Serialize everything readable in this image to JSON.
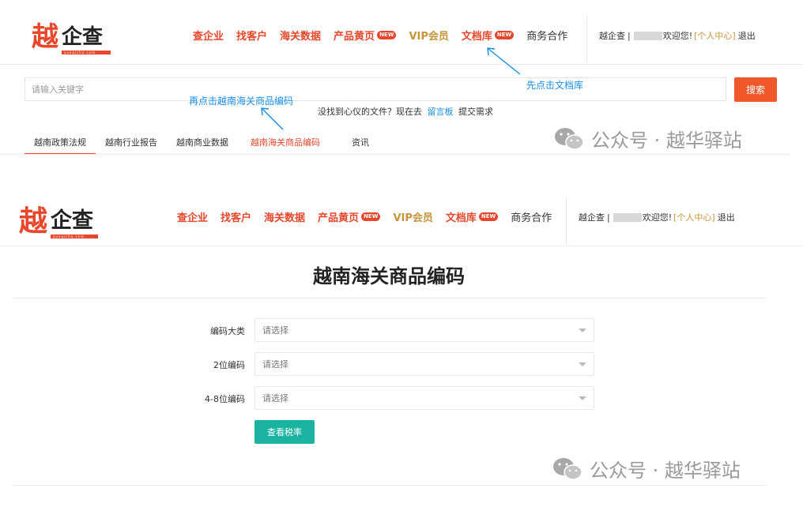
{
  "top": {
    "logo": {
      "char1": "越",
      "rest": "企查",
      "tagline": "yueqicha.com"
    },
    "nav": [
      {
        "label": "查企业",
        "style": "red"
      },
      {
        "label": "找客户",
        "style": "red"
      },
      {
        "label": "海关数据",
        "style": "red"
      },
      {
        "label": "产品黄页",
        "style": "red",
        "badge": "NEW"
      },
      {
        "label": "VIP会员",
        "style": "gold"
      },
      {
        "label": "文档库",
        "style": "red",
        "badge": "NEW"
      },
      {
        "label": "商务合作",
        "style": "dark"
      }
    ],
    "user": {
      "site": "越企查",
      "sep": "|",
      "welcome": "欢迎您!",
      "center": "[个人中心]",
      "logout": "退出"
    },
    "search": {
      "placeholder": "请输入关键字",
      "button": "搜索"
    },
    "hint": {
      "prefix": "没找到心仪的文件？现在去",
      "link": "留言板",
      "suffix": "提交需求"
    },
    "tabs": [
      {
        "label": "越南政策法规",
        "underline": true
      },
      {
        "label": "越南行业报告"
      },
      {
        "label": "越南商业数据"
      },
      {
        "label": "越南海关商品编码",
        "active": true
      },
      {
        "label": "资讯"
      }
    ],
    "annotations": {
      "first": "先点击文档库",
      "second": "再点击越南海关商品编码"
    },
    "watermark": "公众号 · 越华驿站"
  },
  "bottom": {
    "logo": {
      "char1": "越",
      "rest": "企查",
      "tagline": "yueqicha.com"
    },
    "nav": [
      {
        "label": "查企业",
        "style": "red"
      },
      {
        "label": "找客户",
        "style": "red"
      },
      {
        "label": "海关数据",
        "style": "red"
      },
      {
        "label": "产品黄页",
        "style": "red",
        "badge": "NEW"
      },
      {
        "label": "VIP会员",
        "style": "gold"
      },
      {
        "label": "文档库",
        "style": "red",
        "badge": "NEW"
      },
      {
        "label": "商务合作",
        "style": "dark"
      }
    ],
    "user": {
      "site": "越企查",
      "sep": "|",
      "welcome": "欢迎您!",
      "center": "[个人中心]",
      "logout": "退出"
    },
    "title": "越南海关商品编码",
    "form": [
      {
        "label": "编码大类",
        "placeholder": "请选择"
      },
      {
        "label": "2位编码",
        "placeholder": "请选择"
      },
      {
        "label": "4-8位编码",
        "placeholder": "请选择"
      }
    ],
    "query_button": "查看税率",
    "watermark": "公众号 · 越华驿站"
  },
  "colors": {
    "brand_red": "#e8472b",
    "vip_gold": "#c7943a",
    "link_blue": "#1a8ee8",
    "search_orange": "#f0582c",
    "teal": "#1ab2a0"
  }
}
